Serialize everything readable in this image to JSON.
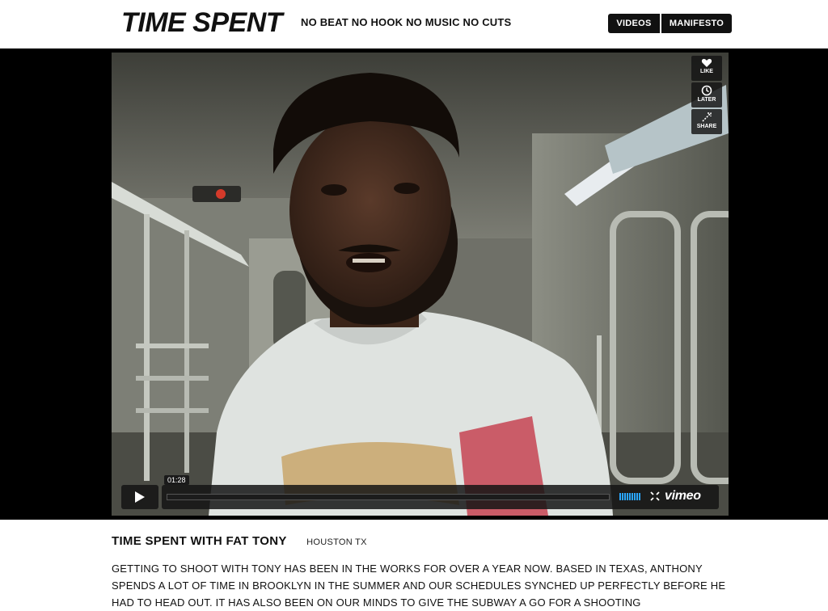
{
  "header": {
    "logo": "TIME SPENT",
    "tagline": "NO BEAT NO HOOK NO MUSIC NO CUTS",
    "nav": [
      "VIDEOS",
      "MANIFESTO"
    ]
  },
  "player": {
    "side_actions": [
      {
        "label": "LIKE",
        "icon": "heart-icon"
      },
      {
        "label": "LATER",
        "icon": "clock-icon"
      },
      {
        "label": "SHARE",
        "icon": "share-icon"
      }
    ],
    "time": "01:28",
    "brand": "vimeo",
    "progress": 0,
    "accent_color": "#2aa6ff"
  },
  "post": {
    "title": "TIME SPENT WITH FAT TONY",
    "location": "HOUSTON TX",
    "body": "GETTING TO SHOOT WITH TONY HAS BEEN IN THE WORKS FOR OVER A YEAR NOW. BASED IN TEXAS, ANTHONY SPENDS A LOT OF TIME IN BROOKLYN IN THE SUMMER AND OUR SCHEDULES SYNCHED UP PERFECTLY BEFORE HE HAD TO HEAD OUT. IT HAS ALSO BEEN ON OUR MINDS TO GIVE THE SUBWAY A GO FOR A SHOOTING"
  }
}
